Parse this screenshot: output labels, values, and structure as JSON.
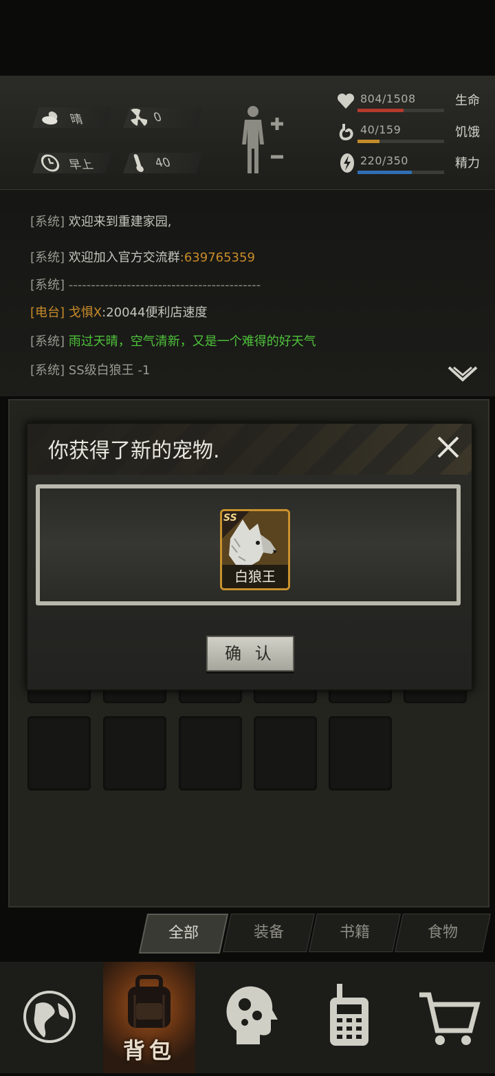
{
  "status": {
    "weather": "晴",
    "radiation": "0",
    "time_of_day": "早上",
    "temperature": "40",
    "stats": [
      {
        "label": "生命",
        "value": "804/1508",
        "fraction": 0.533,
        "color": "#b43a2e",
        "icon": "heart-icon"
      },
      {
        "label": "饥饿",
        "value": "40/159",
        "fraction": 0.25,
        "color": "#c48b2a",
        "icon": "stomach-icon"
      },
      {
        "label": "精力",
        "value": "220/350",
        "fraction": 0.629,
        "color": "#2f6fb4",
        "icon": "energy-icon"
      }
    ]
  },
  "log": {
    "lines": [
      {
        "tag": "[系统]",
        "text": "欢迎来到重建家园,"
      },
      {
        "tag": "[系统]",
        "text": " 欢迎加入官方交流群",
        "extra": ":639765359"
      },
      {
        "tag": "[系统]",
        "text": "-------------------------------------------"
      },
      {
        "tag": "[电台]",
        "text": "戈惧X",
        "extra": ":20044便利店速度"
      },
      {
        "tag": "[系统]",
        "text": "雨过天晴，空气清新，又是一个难得的好天气"
      },
      {
        "tag": "[系统]",
        "text": "SS级白狼王 -1"
      }
    ]
  },
  "tabs": [
    "全部",
    "装备",
    "书籍",
    "食物"
  ],
  "nav": {
    "backpack_label": "背包"
  },
  "modal": {
    "title": "你获得了新的宠物.",
    "pet_name": "白狼王",
    "pet_rank": "SS",
    "confirm": "确 认"
  },
  "colors": {
    "accent_orange": "#c9922c",
    "log_green": "#4ec33a",
    "log_number": "#c98c2a"
  }
}
